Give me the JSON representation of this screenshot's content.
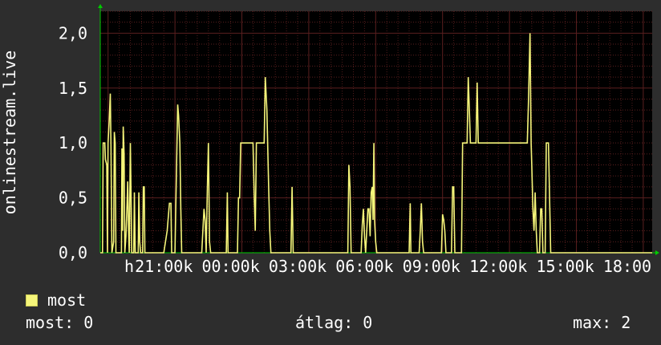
{
  "chart_data": {
    "type": "line",
    "ylabel": "onlinestream.live",
    "xlabel": "",
    "ylim": [
      0,
      2.2
    ],
    "y_ticks": [
      "0,0",
      "0,5",
      "1,0",
      "1,5",
      "2,0"
    ],
    "x_tick_labels": [
      "h",
      "21:00k",
      "00:00k",
      "03:00k",
      "06:00k",
      "09:00k",
      "12:00k",
      "15:00k",
      "18:00"
    ],
    "x_tick_hours": [
      18,
      21,
      24,
      27,
      30,
      33,
      36,
      39,
      42
    ],
    "x_range_hours": [
      17.65,
      42.4
    ],
    "grid": true,
    "series": [
      {
        "name": "most",
        "color": "#f5f57a",
        "points": [
          [
            17.65,
            0
          ],
          [
            17.75,
            0
          ],
          [
            17.78,
            1.0
          ],
          [
            17.85,
            1.0
          ],
          [
            17.88,
            0.85
          ],
          [
            17.94,
            0.8
          ],
          [
            17.97,
            0
          ],
          [
            18.0,
            1.0
          ],
          [
            18.05,
            1.2
          ],
          [
            18.1,
            1.45
          ],
          [
            18.13,
            1.0
          ],
          [
            18.17,
            0
          ],
          [
            18.25,
            0.1
          ],
          [
            18.28,
            1.1
          ],
          [
            18.32,
            1.0
          ],
          [
            18.35,
            0
          ],
          [
            18.6,
            0
          ],
          [
            18.62,
            0.95
          ],
          [
            18.65,
            0.2
          ],
          [
            18.68,
            1.15
          ],
          [
            18.72,
            0.9
          ],
          [
            18.75,
            0
          ],
          [
            18.8,
            0.15
          ],
          [
            18.85,
            0.45
          ],
          [
            18.88,
            0.65
          ],
          [
            18.92,
            0.2
          ],
          [
            18.95,
            0
          ],
          [
            19.0,
            1.0
          ],
          [
            19.03,
            0.5
          ],
          [
            19.06,
            0
          ],
          [
            19.15,
            0
          ],
          [
            19.18,
            0.55
          ],
          [
            19.22,
            0
          ],
          [
            19.35,
            0
          ],
          [
            19.38,
            0.55
          ],
          [
            19.42,
            0.1
          ],
          [
            19.46,
            0
          ],
          [
            19.55,
            0
          ],
          [
            19.58,
            0.6
          ],
          [
            19.62,
            0.6
          ],
          [
            19.65,
            0
          ],
          [
            20.1,
            0
          ],
          [
            20.2,
            0
          ],
          [
            20.5,
            0
          ],
          [
            20.65,
            0.2
          ],
          [
            20.75,
            0.45
          ],
          [
            20.82,
            0.45
          ],
          [
            20.85,
            0
          ],
          [
            21.0,
            0
          ],
          [
            21.12,
            1.35
          ],
          [
            21.16,
            1.25
          ],
          [
            21.22,
            1.0
          ],
          [
            21.26,
            0.4
          ],
          [
            21.3,
            0
          ],
          [
            22.2,
            0
          ],
          [
            22.3,
            0.4
          ],
          [
            22.35,
            0.3
          ],
          [
            22.4,
            0
          ],
          [
            22.45,
            0.55
          ],
          [
            22.5,
            1.0
          ],
          [
            22.55,
            0.1
          ],
          [
            22.6,
            0
          ],
          [
            23.3,
            0
          ],
          [
            23.35,
            0.55
          ],
          [
            23.38,
            0
          ],
          [
            23.8,
            0
          ],
          [
            23.85,
            0.5
          ],
          [
            23.9,
            0.5
          ],
          [
            23.95,
            1.0
          ],
          [
            24.5,
            1.0
          ],
          [
            24.55,
            0.55
          ],
          [
            24.6,
            0.2
          ],
          [
            24.65,
            1.0
          ],
          [
            25.0,
            1.0
          ],
          [
            25.05,
            1.6
          ],
          [
            25.12,
            1.3
          ],
          [
            25.2,
            0.6
          ],
          [
            25.25,
            0.2
          ],
          [
            25.3,
            0
          ],
          [
            26.2,
            0
          ],
          [
            26.25,
            0.6
          ],
          [
            26.3,
            0
          ],
          [
            28.75,
            0
          ],
          [
            28.8,
            0.8
          ],
          [
            28.85,
            0.6
          ],
          [
            28.9,
            0
          ],
          [
            29.35,
            0
          ],
          [
            29.4,
            0.25
          ],
          [
            29.45,
            0.4
          ],
          [
            29.5,
            0.15
          ],
          [
            29.55,
            0
          ],
          [
            29.65,
            0.4
          ],
          [
            29.7,
            0.4
          ],
          [
            29.75,
            0.15
          ],
          [
            29.8,
            0.55
          ],
          [
            29.85,
            0.6
          ],
          [
            29.88,
            0.3
          ],
          [
            29.92,
            1.0
          ],
          [
            29.95,
            0.3
          ],
          [
            30.0,
            0.1
          ],
          [
            30.05,
            0
          ],
          [
            31.5,
            0
          ],
          [
            31.55,
            0.45
          ],
          [
            31.58,
            0
          ],
          [
            31.95,
            0
          ],
          [
            32.0,
            0.2
          ],
          [
            32.05,
            0.45
          ],
          [
            32.1,
            0.1
          ],
          [
            32.15,
            0
          ],
          [
            32.95,
            0
          ],
          [
            33.0,
            0.35
          ],
          [
            33.05,
            0.3
          ],
          [
            33.1,
            0.2
          ],
          [
            33.15,
            0
          ],
          [
            33.4,
            0
          ],
          [
            33.45,
            0.6
          ],
          [
            33.5,
            0.6
          ],
          [
            33.55,
            0
          ],
          [
            33.85,
            0
          ],
          [
            33.9,
            1.0
          ],
          [
            34.1,
            1.0
          ],
          [
            34.15,
            1.6
          ],
          [
            34.2,
            1.3
          ],
          [
            34.25,
            1.0
          ],
          [
            34.5,
            1.0
          ],
          [
            34.55,
            1.55
          ],
          [
            34.6,
            1.0
          ],
          [
            36.8,
            1.0
          ],
          [
            36.85,
            1.35
          ],
          [
            36.92,
            2.0
          ],
          [
            36.97,
            1.0
          ],
          [
            37.0,
            0.8
          ],
          [
            37.05,
            0.4
          ],
          [
            37.1,
            0.2
          ],
          [
            37.15,
            0.55
          ],
          [
            37.2,
            0.2
          ],
          [
            37.25,
            0
          ],
          [
            37.35,
            0
          ],
          [
            37.4,
            0.4
          ],
          [
            37.45,
            0.4
          ],
          [
            37.5,
            0
          ],
          [
            37.6,
            0
          ],
          [
            37.65,
            1.0
          ],
          [
            37.75,
            1.0
          ],
          [
            37.8,
            0.5
          ],
          [
            37.85,
            0
          ],
          [
            42.4,
            0
          ]
        ]
      }
    ]
  },
  "legend": {
    "label": "most"
  },
  "stats": {
    "current": "most: 0",
    "average": "átlag: 0",
    "max": "max: 2"
  },
  "colors": {
    "background": "#2d2d2d",
    "plot_background": "#000000",
    "grid": "#5a1f1f",
    "axis": "#00cc00",
    "series": "#f5f57a"
  }
}
